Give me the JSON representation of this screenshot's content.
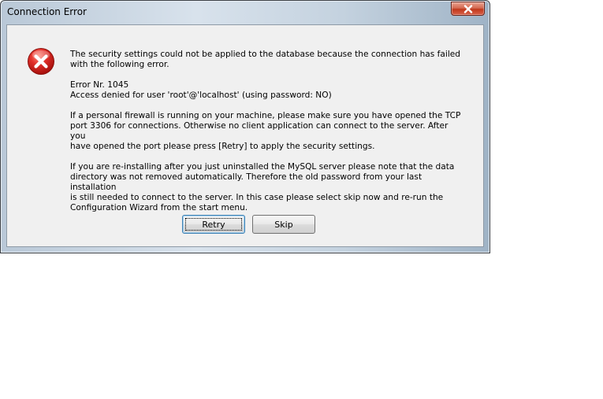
{
  "window": {
    "title": "Connection Error"
  },
  "icons": {
    "error": "error-icon",
    "close": "close-icon"
  },
  "message": {
    "p1": "The security settings could not be applied to the database because the connection has failed\nwith the following error.",
    "p2": "Error Nr. 1045\nAccess denied for user 'root'@'localhost' (using password: NO)",
    "p3": "If a personal firewall is running on your machine, please make sure you have opened the TCP\nport 3306 for connections. Otherwise no client application can connect to the server. After you\nhave opened the port please press [Retry] to apply the security settings.",
    "p4": "If you are re-installing after you just uninstalled the MySQL server please note that the data\ndirectory was not removed automatically. Therefore the old password from your last installation\nis still needed to connect to the server. In this case please select skip now and re-run the\nConfiguration Wizard from the start menu."
  },
  "buttons": {
    "retry": "Retry",
    "skip": "Skip"
  },
  "colors": {
    "error_red": "#d8231e",
    "close_red": "#c1391c",
    "dialog_bg": "#f0f0f0"
  }
}
